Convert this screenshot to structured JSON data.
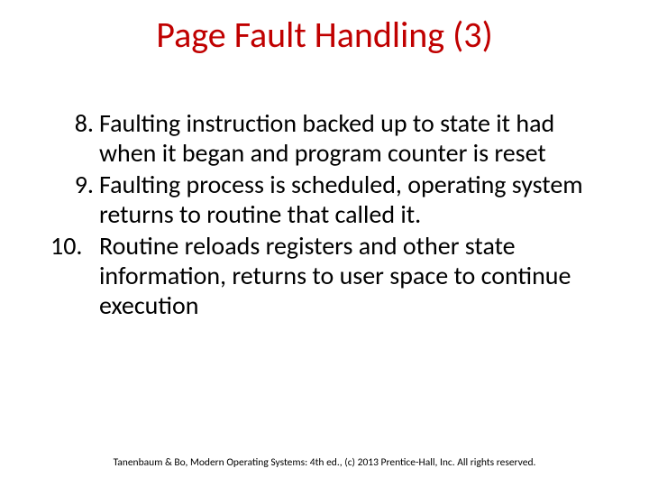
{
  "title": "Page Fault Handling (3)",
  "items": [
    {
      "num": "8.",
      "text": "Faulting instruction backed up to state it had when it began and program counter is reset"
    },
    {
      "num": "9.",
      "text": "Faulting process is scheduled, operating system returns to routine that called it."
    },
    {
      "num": "10.",
      "text": "Routine reloads registers and other state information, returns to user space to continue execution"
    }
  ],
  "footer": "Tanenbaum & Bo, Modern Operating Systems: 4th ed., (c) 2013 Prentice-Hall, Inc. All rights reserved."
}
